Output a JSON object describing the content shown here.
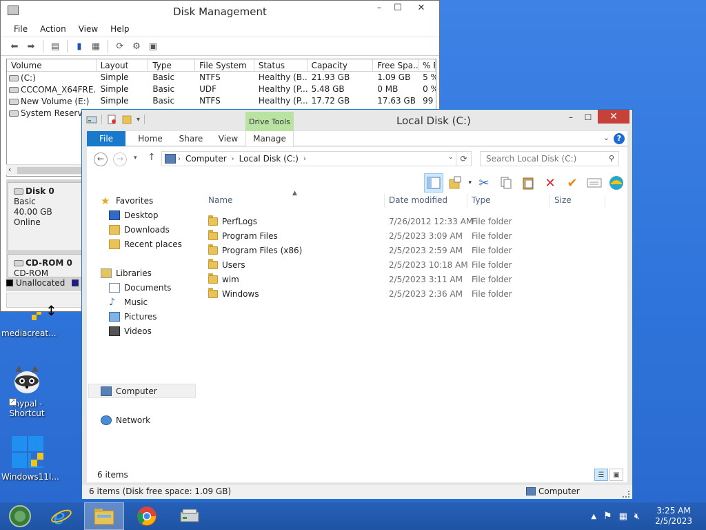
{
  "desktop": {
    "icons": [
      {
        "label": "mediacreat..."
      },
      {
        "label": "mypal - Shortcut"
      },
      {
        "label": "Windows11I..."
      }
    ]
  },
  "disk_mgmt": {
    "title": "Disk Management",
    "menu": [
      "File",
      "Action",
      "View",
      "Help"
    ],
    "columns": [
      "Volume",
      "Layout",
      "Type",
      "File System",
      "Status",
      "Capacity",
      "Free Spa...",
      "% F"
    ],
    "rows": [
      [
        "(C:)",
        "Simple",
        "Basic",
        "NTFS",
        "Healthy (B...",
        "21.93 GB",
        "1.09 GB",
        "5 %"
      ],
      [
        "CCCOMA_X64FRE...",
        "Simple",
        "Basic",
        "UDF",
        "Healthy (P...",
        "5.48 GB",
        "0 MB",
        "0 %"
      ],
      [
        "New Volume (E:)",
        "Simple",
        "Basic",
        "NTFS",
        "Healthy (P...",
        "17.72 GB",
        "17.63 GB",
        "99"
      ],
      [
        "System Reserved",
        "",
        "",
        "",
        "",
        "",
        "",
        ""
      ]
    ],
    "disk0": {
      "name": "Disk 0",
      "type": "Basic",
      "size": "40.00 GB",
      "state": "Online"
    },
    "cdrom0": {
      "name": "CD-ROM 0",
      "type": "CD-ROM"
    },
    "legend": {
      "unallocated": "Unallocated"
    }
  },
  "explorer": {
    "title": "Local Disk (C:)",
    "context_tab": "Drive Tools",
    "tabs": [
      "File",
      "Home",
      "Share",
      "View",
      "Manage"
    ],
    "breadcrumb": [
      "Computer",
      "Local Disk (C:)"
    ],
    "search_placeholder": "Search Local Disk (C:)",
    "columns": [
      "Name",
      "Date modified",
      "Type",
      "Size"
    ],
    "nav": {
      "favorites": "Favorites",
      "desktop": "Desktop",
      "downloads": "Downloads",
      "recent": "Recent places",
      "libraries": "Libraries",
      "documents": "Documents",
      "music": "Music",
      "pictures": "Pictures",
      "videos": "Videos",
      "computer": "Computer",
      "network": "Network"
    },
    "files": [
      {
        "name": "PerfLogs",
        "date": "7/26/2012 12:33 AM",
        "type": "File folder"
      },
      {
        "name": "Program Files",
        "date": "2/5/2023 3:09 AM",
        "type": "File folder"
      },
      {
        "name": "Program Files (x86)",
        "date": "2/5/2023 2:59 AM",
        "type": "File folder"
      },
      {
        "name": "Users",
        "date": "2/5/2023 10:18 AM",
        "type": "File folder"
      },
      {
        "name": "wim",
        "date": "2/5/2023 3:11 AM",
        "type": "File folder"
      },
      {
        "name": "Windows",
        "date": "2/5/2023 2:36 AM",
        "type": "File folder"
      }
    ],
    "item_count": "6 items",
    "status_text": "6 items (Disk free space: 1.09 GB)",
    "status_location": "Computer"
  },
  "taskbar": {
    "time": "3:25 AM",
    "date": "2/5/2023"
  },
  "colors": {
    "accent": "#1979ca",
    "close": "#c7413b",
    "drive_tools": "#b9e3a2",
    "desktop": "#2f74da"
  }
}
